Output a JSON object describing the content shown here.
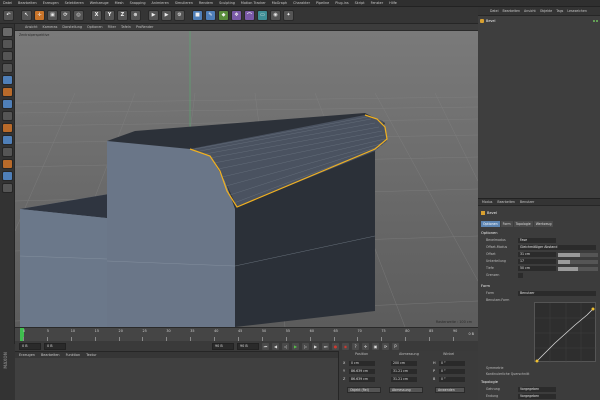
{
  "menubar": [
    "Datei",
    "Bearbeiten",
    "Erzeugen",
    "Selektieren",
    "Werkzeuge",
    "Mesh",
    "Snapping",
    "Animieren",
    "Simulieren",
    "Rendern",
    "Sculpting",
    "Motion Tracker",
    "MoGraph",
    "Charakter",
    "Pipeline",
    "Plug-ins",
    "Skript",
    "Fenster",
    "Hilfe"
  ],
  "toolbar": {
    "axis_labels": [
      "X",
      "Y",
      "Z"
    ]
  },
  "viewport": {
    "menu": [
      "Ansicht",
      "Kameras",
      "Darstellung",
      "Optionen",
      "Filter",
      "Tafeln",
      "ProRender"
    ],
    "title": "Zentralperspektive",
    "scale": "Rasterweite : 100 cm",
    "colors": {
      "background": "#6f6f6f",
      "selection": "#f0b020"
    }
  },
  "timeline": {
    "ticks": [
      "0",
      "5",
      "10",
      "15",
      "20",
      "25",
      "30",
      "35",
      "40",
      "45",
      "50",
      "55",
      "60",
      "65",
      "70",
      "75",
      "80",
      "85",
      "90"
    ],
    "end_label": "0 B"
  },
  "transport": {
    "start": "0 B",
    "current": "0 B",
    "end": "90 B",
    "max": "90 B"
  },
  "materials": {
    "menu": [
      "Erzeugen",
      "Bearbeiten",
      "Funktion",
      "Textur"
    ]
  },
  "coordinates": {
    "headers": [
      "Position",
      "Abmessung",
      "Winkel"
    ],
    "rows": [
      {
        "axis": "X",
        "pos": "0 cm",
        "size": "200 cm",
        "rot_axis": "H",
        "rot": "0 °"
      },
      {
        "axis": "Y",
        "pos": "86.639 cm",
        "size": "31.21 cm",
        "rot_axis": "P",
        "rot": "0 °"
      },
      {
        "axis": "Z",
        "pos": "86.639 cm",
        "size": "31.21 cm",
        "rot_axis": "B",
        "rot": "0 °"
      }
    ],
    "mode_select": "Objekt (Rel)",
    "size_select": "Abmessung",
    "apply_button": "Anwenden"
  },
  "object_manager": {
    "menu": [
      "Datei",
      "Bearbeiten",
      "Ansicht",
      "Objekte",
      "Tags",
      "Lesezeichen"
    ],
    "objects": [
      {
        "name": "Bevel"
      }
    ]
  },
  "attribute_manager": {
    "menu": [
      "Modus",
      "Bearbeiten",
      "Benutzer"
    ],
    "title": "Bevel",
    "tabs": [
      {
        "label": "Optionen",
        "active": true
      },
      {
        "label": "Form",
        "active": false
      },
      {
        "label": "Topologie",
        "active": false
      },
      {
        "label": "Werkzeug",
        "active": false
      }
    ],
    "options_head": "Optionen",
    "fields": [
      {
        "label": "Bevelmodus",
        "value": "Fase"
      },
      {
        "label": "Offset-Modus",
        "value": "Gleichmäßiger Abstand"
      },
      {
        "label": "Offset",
        "value": "31 cm",
        "fraction": 0.55
      },
      {
        "label": "Unterteilung",
        "value": "17",
        "fraction": 0.3
      },
      {
        "label": "Tiefe",
        "value": "50 cm",
        "fraction": 0.5
      },
      {
        "label": "Grenzen",
        "value": ""
      }
    ],
    "form_head": "Form",
    "form_fields": [
      {
        "label": "Form",
        "value": "Benutzer"
      },
      {
        "label": "Benutzer-Form",
        "value": ""
      }
    ],
    "symmetry_label": "Symmetrie",
    "curve_label": "Kontinuierliche Querschnitt",
    "topology_head": "Topologie",
    "topology_fields": [
      {
        "label": "Gehrung",
        "value": "Vorgegeben"
      },
      {
        "label": "Endung",
        "value": "Vorgegeben"
      }
    ]
  }
}
